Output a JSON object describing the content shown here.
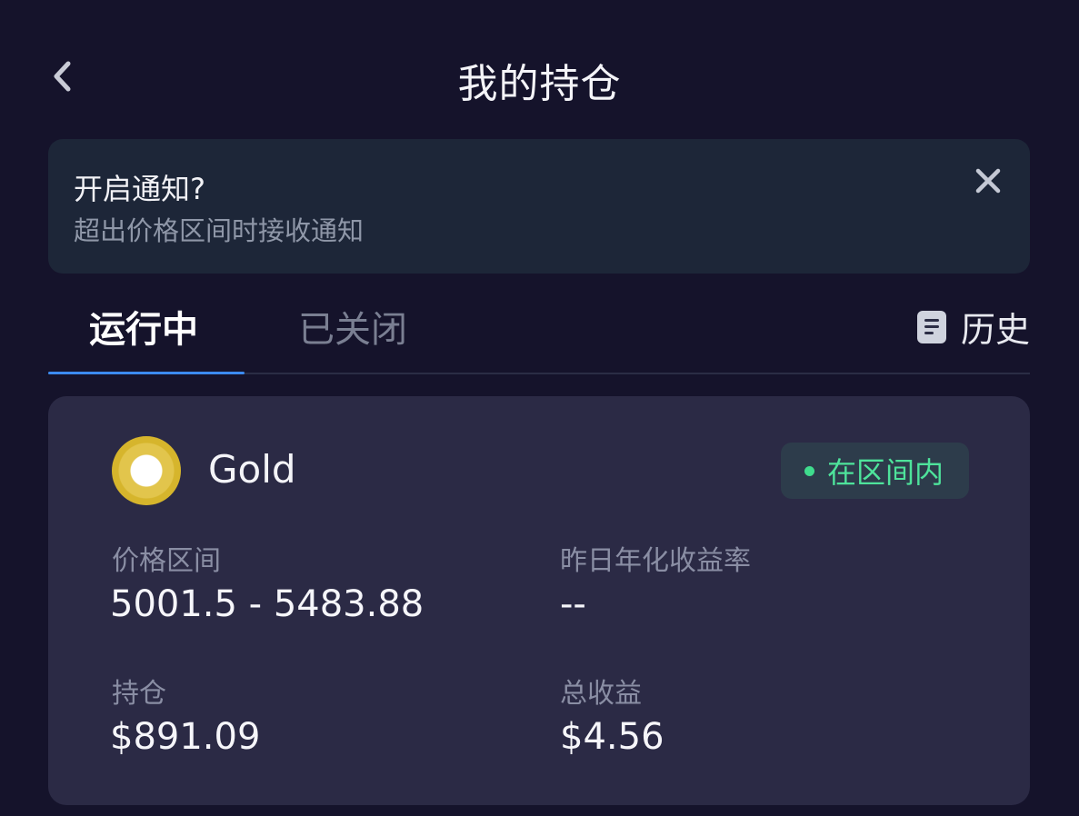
{
  "header": {
    "title": "我的持仓"
  },
  "notification": {
    "title": "开启通知?",
    "subtitle": "超出价格区间时接收通知"
  },
  "tabs": [
    {
      "label": "运行中",
      "active": true
    },
    {
      "label": "已关闭",
      "active": false
    }
  ],
  "history": {
    "label": "历史",
    "icon": "document-icon"
  },
  "position": {
    "asset_name": "Gold",
    "status": "在区间内",
    "status_color": "#4ee39b",
    "price_range_label": "价格区间",
    "price_range_value": "5001.5 - 5483.88",
    "apr_label": "昨日年化收益率",
    "apr_value": "--",
    "holding_label": "持仓",
    "holding_value": "$891.09",
    "total_earnings_label": "总收益",
    "total_earnings_value": "$4.56"
  },
  "colors": {
    "background": "#15132b",
    "banner": "#1d2638",
    "card": "#2b2a45",
    "accent": "#3c8bf0"
  }
}
